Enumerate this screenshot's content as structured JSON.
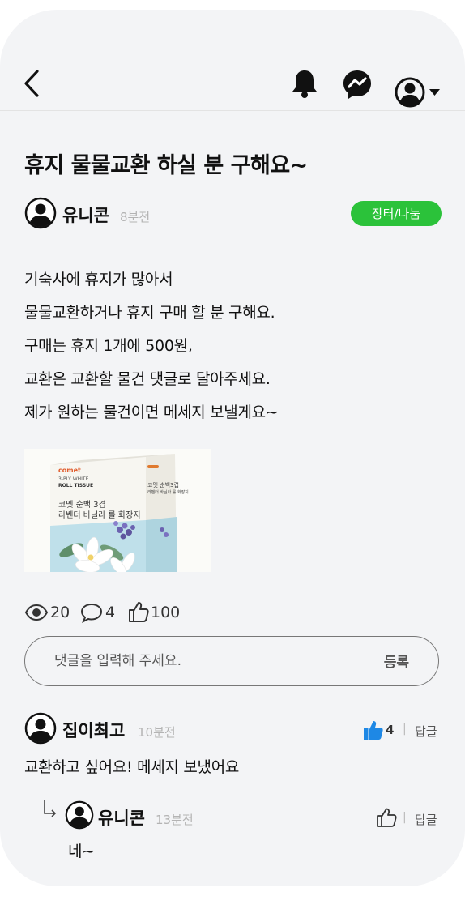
{
  "header": {
    "back_icon": "chevron-left-icon",
    "bell_icon": "bell-icon",
    "messenger_icon": "messenger-icon",
    "profile_icon": "user-circle-icon"
  },
  "post": {
    "title": "휴지 물물교환 하실 분 구해요~",
    "author": "유니콘",
    "time": "8분전",
    "category": "장터/나눔",
    "body": [
      "기숙사에 휴지가 많아서",
      "물물교환하거나 휴지 구매 할 분 구해요.",
      "구매는 휴지 1개에 500원,",
      "교환은 교환할 물건 댓글로 달아주세요.",
      "제가 원하는 물건이면 메세지 보낼게요~"
    ],
    "product_label": {
      "brand": "comet",
      "line1": "3-PLY WHITE",
      "line2": "ROLL TISSUE",
      "line3": "코멧 순백 3겹",
      "line4": "라벤더 바닐라 롤 화장지",
      "side1": "코멧 순백3겹",
      "side2": "라벤더 바닐라 롤 화장지"
    },
    "stats": {
      "views": "20",
      "comments": "4",
      "likes": "100"
    }
  },
  "comment_input": {
    "placeholder": "댓글을 입력해 주세요.",
    "submit_label": "등록"
  },
  "comments": [
    {
      "author": "집이최고",
      "time": "10분전",
      "likes": "4",
      "reply_label": "답글",
      "text": "교환하고 싶어요! 메세지 보냈어요"
    }
  ],
  "replies": [
    {
      "author": "유니콘",
      "time": "13분전",
      "reply_label": "답글",
      "text": "네~"
    }
  ],
  "colors": {
    "accent_green": "#2bc23a",
    "like_blue": "#1e88e5",
    "background": "#f3f4f6"
  }
}
